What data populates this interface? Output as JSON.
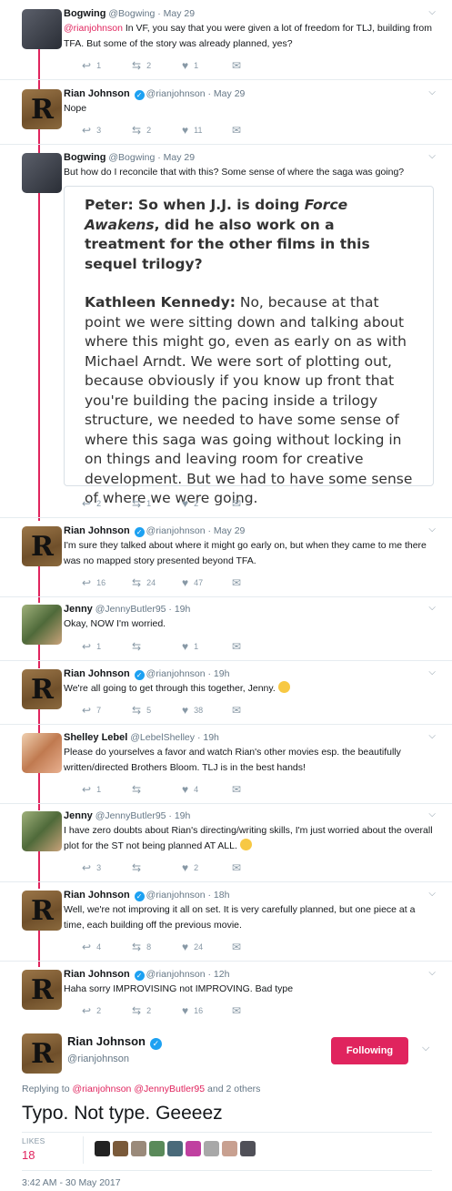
{
  "tweets": [
    {
      "name": "Bogwing",
      "handle": "@Bogwing · May 29",
      "mention": "@rianjohnson",
      "text": " In VF, you say that you were given a lot of freedom for TLJ, building from TFA. But some of the story was already planned, yes?",
      "reply": "1",
      "retweet": "2",
      "like": "1"
    },
    {
      "name": "Rian Johnson",
      "handle": "@rianjohnson · May 29",
      "text": "Nope",
      "reply": "3",
      "retweet": "2",
      "like": "11"
    },
    {
      "name": "Bogwing",
      "handle": "@Bogwing · May 29",
      "text": "But how do I reconcile that with this? Some sense of where the saga was going?",
      "reply": "2",
      "retweet": "1",
      "like": "2"
    },
    {
      "name": "Rian Johnson",
      "handle": "@rianjohnson · May 29",
      "text": "I'm sure they talked about where it might go early on, but when they came to me there was no mapped story presented beyond TFA.",
      "reply": "16",
      "retweet": "24",
      "like": "47"
    },
    {
      "name": "Jenny",
      "handle": "@JennyButler95 · 19h",
      "text": "Okay, NOW I'm worried.",
      "reply": "1",
      "retweet": "",
      "like": "1"
    },
    {
      "name": "Rian Johnson",
      "handle": "@rianjohnson · 19h",
      "text": "We're all going to get through this together, Jenny.",
      "reply": "7",
      "retweet": "5",
      "like": "38"
    },
    {
      "name": "Shelley Lebel",
      "handle": "@LebelShelley · 19h",
      "text": "Please do yourselves a favor and watch Rian's other movies esp. the beautifully written/directed Brothers Bloom. TLJ is in the best hands!",
      "reply": "1",
      "retweet": "",
      "like": "4"
    },
    {
      "name": "Jenny",
      "handle": "@JennyButler95 · 19h",
      "text": "I have zero doubts about Rian's directing/writing skills, I'm just worried about the overall plot for the ST not being planned AT ALL.",
      "reply": "3",
      "retweet": "",
      "like": "2"
    },
    {
      "name": "Rian Johnson",
      "handle": "@rianjohnson · 18h",
      "text": "Well, we're not improving it all on set. It is very carefully planned, but one piece at a time, each building off the previous movie.",
      "reply": "4",
      "retweet": "8",
      "like": "24"
    },
    {
      "name": "Rian Johnson",
      "handle": "@rianjohnson · 12h",
      "text": "Haha sorry IMPROVISING not IMPROVING. Bad type",
      "reply": "2",
      "retweet": "2",
      "like": "16"
    }
  ],
  "quote": {
    "q_label": "Peter: So when J.J. is doing ",
    "q_italic": "Force Awakens",
    "q_rest": ", did he also work on a treatment for the other films in this sequel trilogy?",
    "a_label": "Kathleen Kennedy:",
    "a_text": " No, because at that point we were sitting down and talking about where this might go, even as early on as with Michael Arndt. We were sort of plotting out, because obviously if you know up front that you're building the pacing inside a trilogy structure, we needed to have some sense of where this saga was going without locking in on things and leaving room for creative development. But we had to have some sense of where we were going."
  },
  "main": {
    "name": "Rian Johnson",
    "handle": "@rianjohnson",
    "follow_label": "Following",
    "replying_prefix": "Replying to ",
    "replying_m1": "@rianjohnson",
    "replying_m2": "@JennyButler95",
    "replying_suffix": " and 2 others",
    "text": "Typo. Not type. Geeeez",
    "likes_label": "LIKES",
    "likes_count": "18",
    "timestamp": "3:42 AM - 30 May 2017"
  },
  "colors": {
    "accent": "#e0245e",
    "verified": "#1da1f2",
    "muted": "#657786"
  },
  "icons": [
    "reply-icon",
    "retweet-icon",
    "heart-icon",
    "dm-icon",
    "chevron-down-icon",
    "verified-icon"
  ]
}
